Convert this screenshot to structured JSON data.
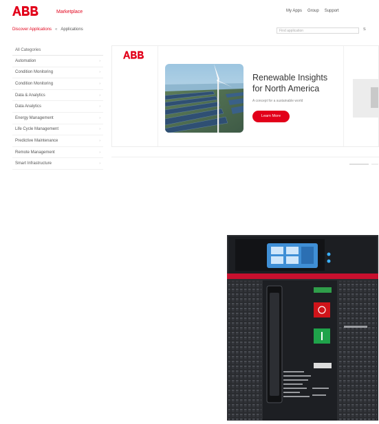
{
  "header": {
    "logo_text": "ABB",
    "marketplace_label": "Marketplace",
    "top_links": [
      "My Apps",
      "Group",
      "Support"
    ]
  },
  "breadcrumb": {
    "root": "Discover Applications",
    "separator": "«",
    "current": "Applications"
  },
  "search": {
    "placeholder": "Find application",
    "button_label": "S"
  },
  "sidebar": {
    "heading": "All Categories",
    "items": [
      {
        "label": "Automation"
      },
      {
        "label": "Condition Monitoring"
      },
      {
        "label": "Condition Monitoring"
      },
      {
        "label": "Data & Analytics"
      },
      {
        "label": "Data Analytics"
      },
      {
        "label": "Energy Management"
      },
      {
        "label": "Life Cycle Management"
      },
      {
        "label": "Predictive Maintenance"
      },
      {
        "label": "Remote Management"
      },
      {
        "label": "Smart Infrastructure"
      }
    ]
  },
  "banner": {
    "logo_text": "ABB",
    "title": "Renewable Insights for North America",
    "subtitle": "A concept for a sustainable world",
    "button_label": "Learn More"
  },
  "colors": {
    "brand": "#e2001a",
    "dark": "#333333"
  },
  "icons": {
    "sidebar_chevron": "chevron-right-icon",
    "banner_image": "solar-wind-farm-image",
    "product": "circuit-breaker-image"
  }
}
